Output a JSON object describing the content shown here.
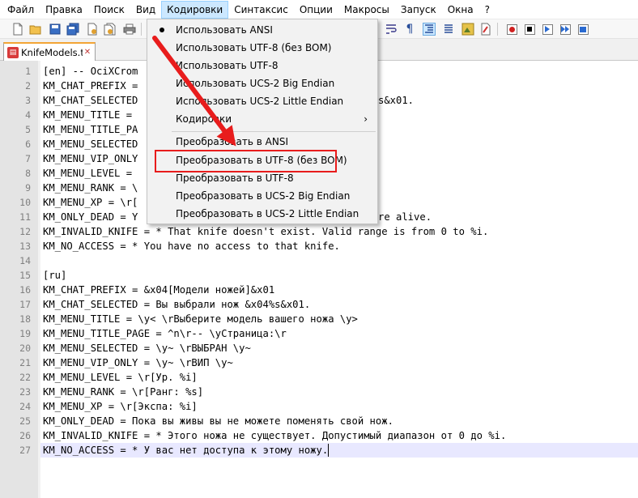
{
  "menubar": {
    "items": [
      "Файл",
      "Правка",
      "Поиск",
      "Вид",
      "Кодировки",
      "Синтаксис",
      "Опции",
      "Макросы",
      "Запуск",
      "Окна",
      "?"
    ],
    "active_index": 4
  },
  "toolbar": {
    "icons": [
      "new-file-icon",
      "open-file-icon",
      "save-icon",
      "save-all-icon",
      "close-icon",
      "close-all-icon",
      "print-icon",
      "word-wrap-icon",
      "show-all-chars-icon",
      "indent-guide-icon",
      "function-list-icon",
      "folder-workspace-icon",
      "record-macro-icon",
      "stop-record-icon",
      "play-macro-icon",
      "run-macro-multiple-icon",
      "save-macro-icon"
    ]
  },
  "tab": {
    "label": "KnifeModels.txt"
  },
  "editor": {
    "lines": [
      {
        "n": "1",
        "text": "[en] -- OciXCrom"
      },
      {
        "n": "2",
        "text": "KM_CHAT_PREFIX ="
      },
      {
        "n": "3",
        "text": "KM_CHAT_SELECTED"
      },
      {
        "n": "4",
        "text": "KM_MENU_TITLE ="
      },
      {
        "n": "5",
        "text": "KM_MENU_TITLE_PA"
      },
      {
        "n": "6",
        "text": "KM_MENU_SELECTED"
      },
      {
        "n": "7",
        "text": "KM_MENU_VIP_ONLY"
      },
      {
        "n": "8",
        "text": "KM_MENU_LEVEL ="
      },
      {
        "n": "9",
        "text": "KM_MENU_RANK = \\"
      },
      {
        "n": "10",
        "text": "KM_MENU_XP = \\r["
      },
      {
        "n": "11",
        "text": "KM_ONLY_DEAD = Y"
      },
      {
        "n": "12",
        "text": "KM_INVALID_KNIFE = * That knife doesn't exist. Valid range is from 0 to %i."
      },
      {
        "n": "13",
        "text": "KM_NO_ACCESS = * You have no access to that knife."
      },
      {
        "n": "14",
        "text": ""
      },
      {
        "n": "15",
        "text": "[ru]"
      },
      {
        "n": "16",
        "text": "KM_CHAT_PREFIX = &x04[Модели ножей]&x01"
      },
      {
        "n": "17",
        "text": "KM_CHAT_SELECTED = Вы выбрали нож &x04%s&x01."
      },
      {
        "n": "18",
        "text": "KM_MENU_TITLE = \\y< \\rВыберите модель вашего ножа \\y>"
      },
      {
        "n": "19",
        "text": "KM_MENU_TITLE_PAGE = ^n\\r-- \\yСтраница:\\r"
      },
      {
        "n": "20",
        "text": "KM_MENU_SELECTED = \\y~ \\rВЫБРАН \\y~"
      },
      {
        "n": "21",
        "text": "KM_MENU_VIP_ONLY = \\y~ \\rВИП \\y~"
      },
      {
        "n": "22",
        "text": "KM_MENU_LEVEL = \\r[Ур. %i]"
      },
      {
        "n": "23",
        "text": "KM_MENU_RANK = \\r[Ранг: %s]"
      },
      {
        "n": "24",
        "text": "KM_MENU_XP = \\r[Экспа: %i]"
      },
      {
        "n": "25",
        "text": "KM_ONLY_DEAD = Пока вы живы вы не можете поменять свой нож."
      },
      {
        "n": "26",
        "text": "KM_INVALID_KNIFE = * Этого ножа не существует. Допустимый диапазон от 0 до %i."
      },
      {
        "n": "27",
        "text": "KM_NO_ACCESS = * У вас нет доступа к этому ножу."
      }
    ],
    "peek_fragments": {
      "line3": "s&x01.",
      "line11": "re alive."
    }
  },
  "dropdown": {
    "items": [
      {
        "label": "Использовать ANSI",
        "checked": true
      },
      {
        "label": "Использовать UTF-8 (без BOM)"
      },
      {
        "label": "Использовать UTF-8"
      },
      {
        "label": "Использовать UCS-2 Big Endian"
      },
      {
        "label": "Использовать UCS-2 Little Endian"
      },
      {
        "label": "Кодировки",
        "submenu": true
      },
      {
        "label": "Преобразовать в ANSI"
      },
      {
        "label": "Преобразовать в UTF-8 (без BOM)",
        "highlighted": true
      },
      {
        "label": "Преобразовать в UTF-8"
      },
      {
        "label": "Преобразовать в UCS-2 Big Endian"
      },
      {
        "label": "Преобразовать в UCS-2 Little Endian"
      }
    ],
    "submenu_arrow": "›",
    "bullet": "•"
  },
  "colors": {
    "annotation": "#e81c1c",
    "current_line": "#e8e8ff",
    "gutter": "#e4e4e4",
    "tab_accent": "#f3a535"
  }
}
